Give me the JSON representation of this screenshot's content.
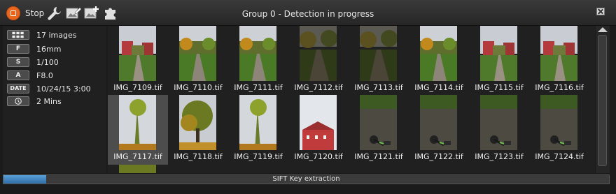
{
  "toolbar": {
    "stop_label": "Stop",
    "icons": [
      "wrench-icon",
      "image-edit-icon",
      "image-add-icon",
      "puzzle-icon"
    ]
  },
  "window": {
    "title": "Group 0 - Detection in progress"
  },
  "info": {
    "images": {
      "icon": "grid-icon",
      "value": "17 images"
    },
    "focal": {
      "badge": "F",
      "value": "16mm"
    },
    "shutter": {
      "badge": "S",
      "value": "1/100"
    },
    "aperture": {
      "badge": "A",
      "value": "F8.0"
    },
    "date": {
      "badge": "DATE",
      "value": "10/24/15 3:00"
    },
    "duration": {
      "icon": "clock-icon",
      "value": "2 Mins"
    }
  },
  "images": [
    {
      "name": "IMG_7109.tif",
      "scene": "red"
    },
    {
      "name": "IMG_7110.tif",
      "scene": "park"
    },
    {
      "name": "IMG_7111.tif",
      "scene": "park"
    },
    {
      "name": "IMG_7112.tif",
      "scene": "dark"
    },
    {
      "name": "IMG_7113.tif",
      "scene": "dark"
    },
    {
      "name": "IMG_7114.tif",
      "scene": "park"
    },
    {
      "name": "IMG_7115.tif",
      "scene": "red"
    },
    {
      "name": "IMG_7116.tif",
      "scene": "red"
    },
    {
      "name": "IMG_7117.tif",
      "scene": "sky",
      "selected": true
    },
    {
      "name": "IMG_7118.tif",
      "scene": "tree"
    },
    {
      "name": "IMG_7119.tif",
      "scene": "sky"
    },
    {
      "name": "IMG_7120.tif",
      "scene": "building"
    },
    {
      "name": "IMG_7121.tif",
      "scene": "ground"
    },
    {
      "name": "IMG_7122.tif",
      "scene": "ground"
    },
    {
      "name": "IMG_7123.tif",
      "scene": "ground"
    },
    {
      "name": "IMG_7124.tif",
      "scene": "ground"
    }
  ],
  "status": {
    "label": "SIFT Key extraction",
    "progress": 0.07,
    "color": "#3c86c4"
  }
}
